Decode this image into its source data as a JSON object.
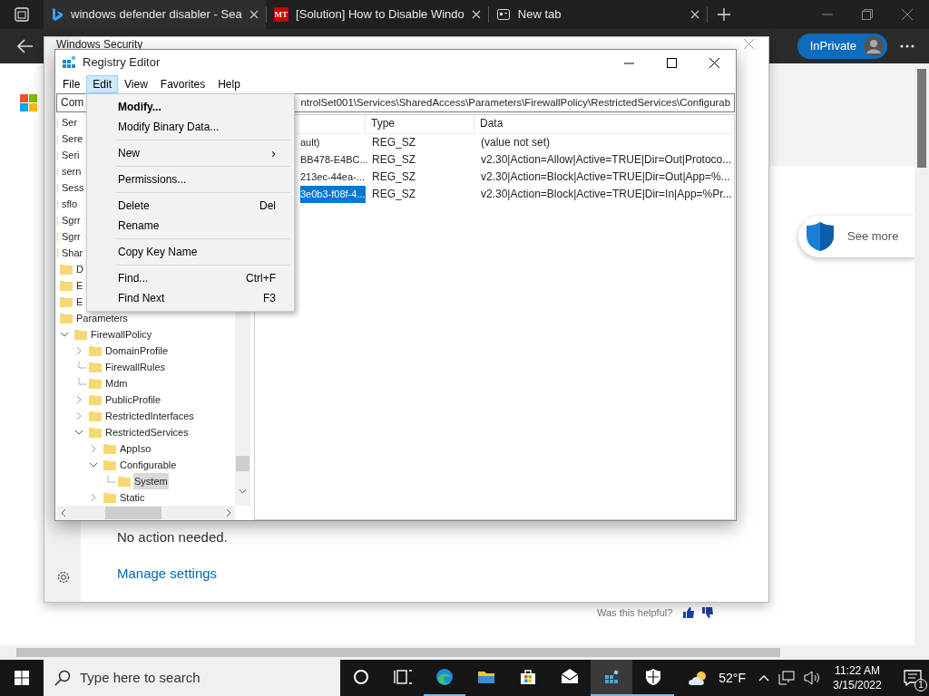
{
  "browser": {
    "tabs": [
      {
        "title": "windows defender disabler - Sea",
        "selected": true
      },
      {
        "title": "[Solution] How to Disable Windo",
        "favicon_text": "MT",
        "selected": false
      },
      {
        "title": "New tab",
        "selected": false
      }
    ],
    "profile_label": "InPrivate"
  },
  "page": {
    "see_more": "See more",
    "helpful": "Was this helpful?"
  },
  "security_window": {
    "title": "Windows Security",
    "status": "No action needed.",
    "link": "Manage settings"
  },
  "registry": {
    "title": "Registry Editor",
    "menu": [
      {
        "label": "File",
        "selected": false
      },
      {
        "label": "Edit",
        "selected": true
      },
      {
        "label": "View",
        "selected": false
      },
      {
        "label": "Favorites",
        "selected": false
      },
      {
        "label": "Help",
        "selected": false
      }
    ],
    "address_start": "Com",
    "address_end": "ntrolSet001\\Services\\SharedAccess\\Parameters\\FirewallPolicy\\RestrictedServices\\Configurab",
    "tree": [
      {
        "name": "Ser",
        "selected": false
      },
      {
        "name": "Sere",
        "selected": false
      },
      {
        "name": "Seri",
        "selected": false
      },
      {
        "name": "sern",
        "selected": false
      },
      {
        "name": "Sess",
        "selected": false
      },
      {
        "name": "sflo",
        "selected": false
      },
      {
        "name": "Sgrr",
        "selected": false
      },
      {
        "name": "Sgrr",
        "selected": false
      },
      {
        "name": "Shar",
        "selected": false,
        "children": [
          {
            "name": "D",
            "selected": false
          },
          {
            "name": "E",
            "selected": false
          },
          {
            "name": "E",
            "selected": false
          },
          {
            "name": "Parameters",
            "selected": false,
            "children": [
              {
                "name": "FirewallPolicy",
                "kind": "branch",
                "expanded": true,
                "selected": false,
                "children": [
                  {
                    "name": "DomainProfile",
                    "kind": "branch",
                    "expanded": false,
                    "selected": false
                  },
                  {
                    "name": "FirewallRules",
                    "kind": "leaf",
                    "selected": false
                  },
                  {
                    "name": "Mdm",
                    "kind": "leaf",
                    "selected": false
                  },
                  {
                    "name": "PublicProfile",
                    "kind": "branch",
                    "expanded": false,
                    "selected": false
                  },
                  {
                    "name": "RestrictedInterfaces",
                    "kind": "branch",
                    "expanded": false,
                    "selected": false
                  },
                  {
                    "name": "RestrictedServices",
                    "kind": "branch",
                    "expanded": true,
                    "selected": false,
                    "children": [
                      {
                        "name": "AppIso",
                        "kind": "branch",
                        "expanded": false,
                        "selected": false
                      },
                      {
                        "name": "Configurable",
                        "kind": "branch",
                        "expanded": true,
                        "selected": false,
                        "children": [
                          {
                            "name": "System",
                            "kind": "leaf",
                            "selected": true
                          }
                        ]
                      },
                      {
                        "name": "Static",
                        "kind": "branch",
                        "expanded": false,
                        "selected": false
                      }
                    ]
                  }
                ]
              }
            ]
          }
        ]
      }
    ],
    "columns": [
      "Type",
      "Data"
    ],
    "rows": [
      {
        "name": "ault)",
        "type": "REG_SZ",
        "data": "(value not set)",
        "selected": false
      },
      {
        "name": "BB478-E4BC...",
        "type": "REG_SZ",
        "data": "v2.30|Action=Allow|Active=TRUE|Dir=Out|Protoco...",
        "selected": false
      },
      {
        "name": "213ec-44ea-...",
        "type": "REG_SZ",
        "data": "v2.30|Action=Block|Active=TRUE|Dir=Out|App=%...",
        "selected": false
      },
      {
        "name": "3e0b3-f08f-4...",
        "type": "REG_SZ",
        "data": "v2.30|Action=Block|Active=TRUE|Dir=In|App=%Pr...",
        "selected": true
      }
    ]
  },
  "edit_menu": [
    {
      "kind": "item",
      "label": "Modify...",
      "default": true
    },
    {
      "kind": "item",
      "label": "Modify Binary Data...",
      "default": false
    },
    {
      "kind": "separator"
    },
    {
      "kind": "submenu",
      "label": "New",
      "arrow": "›",
      "default": false
    },
    {
      "kind": "separator"
    },
    {
      "kind": "item",
      "label": "Permissions...",
      "default": false
    },
    {
      "kind": "separator"
    },
    {
      "kind": "item",
      "label": "Delete",
      "shortcut": "Del",
      "default": false
    },
    {
      "kind": "item",
      "label": "Rename",
      "default": false
    },
    {
      "kind": "separator"
    },
    {
      "kind": "item",
      "label": "Copy Key Name",
      "default": false
    },
    {
      "kind": "separator"
    },
    {
      "kind": "item",
      "label": "Find...",
      "shortcut": "Ctrl+F",
      "default": false
    },
    {
      "kind": "item",
      "label": "Find Next",
      "shortcut": "F3",
      "default": false
    }
  ],
  "taskbar": {
    "search_placeholder": "Type here to search",
    "apps": [
      {
        "kind": "cortana",
        "running": false,
        "selected": false
      },
      {
        "kind": "taskview",
        "running": false,
        "selected": false
      },
      {
        "kind": "edge",
        "running": true,
        "selected": false
      },
      {
        "kind": "explorer",
        "running": false,
        "selected": false
      },
      {
        "kind": "store",
        "running": false,
        "selected": false
      },
      {
        "kind": "mail",
        "running": false,
        "selected": false
      },
      {
        "kind": "regedit",
        "running": true,
        "selected": true
      },
      {
        "kind": "security",
        "running": true,
        "selected": false
      }
    ],
    "temperature": "52°F",
    "time": "11:22 AM",
    "date": "3/15/2022",
    "notifications": "1"
  }
}
